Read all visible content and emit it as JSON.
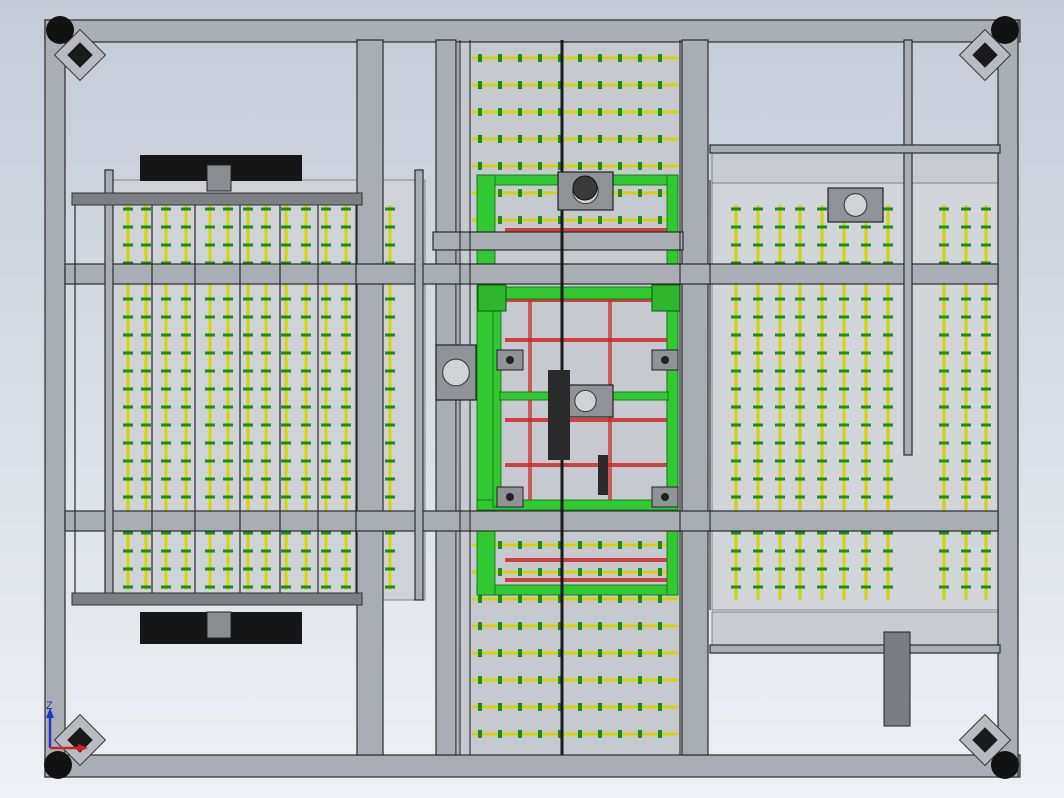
{
  "view": {
    "background_top": "#c4cbd7",
    "background_bottom": "#eef0f5",
    "frame_color": "#a9aeb5",
    "frame_edge": "#2b2b2b",
    "roller_color": "#d4d400",
    "roller_ring_color": "#1e8a1e",
    "green_frame_color": "#32c832",
    "red_belt_color": "#cc2a2a",
    "dark_block_color": "#161616",
    "plate_color": "#7c7f84"
  },
  "triad": {
    "axis_label": "Z",
    "z_color": "#2233cc",
    "x_color": "#cc2222"
  }
}
